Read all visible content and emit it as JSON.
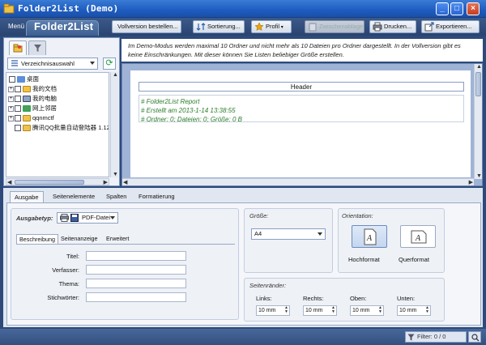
{
  "window": {
    "title": "Folder2List (Demo)"
  },
  "toolbar": {
    "menu": "Menü",
    "brand": "Folder2List",
    "buttons": {
      "buy": "Vollversion bestellen...",
      "sort": "Sortierung...",
      "profile": "Profil",
      "clipboard": "Zwischenablage",
      "print": "Drucken...",
      "export": "Exportieren..."
    }
  },
  "info_text": "Im Demo-Modus werden maximal 10 Ordner und nicht mehr als 10 Dateien pro Ordner dargestellt. In der Vollversion gibt es keine Einschränkungen. Mit dieser können Sie Listen beliebiger Größe erstellen.",
  "left": {
    "selector": "Verzeichnisauswahl",
    "tree": [
      {
        "label": "桌面",
        "level": 0
      },
      {
        "label": "我的文档",
        "level": 1
      },
      {
        "label": "我的电脑",
        "level": 1
      },
      {
        "label": "网上邻居",
        "level": 1
      },
      {
        "label": "qqnmctf",
        "level": 1
      },
      {
        "label": "腾讯QQ批量自动登陆器 1.12",
        "level": 1
      }
    ]
  },
  "preview": {
    "header": "Header",
    "lines": [
      "# Folder2List Report",
      "# Erstellt am 2013-1-14 13:38:55",
      "# Ordner: 0;  Dateien: 0;  Größe: 0 B"
    ]
  },
  "options": {
    "tabs": [
      "Ausgabe",
      "Seitenelemente",
      "Spalten",
      "Formatierung"
    ],
    "output_type_label": "Ausgabetyp:",
    "output_type": "PDF-Datei",
    "subtabs": [
      "Beschreibung",
      "Seitenanzeige",
      "Erweitert"
    ],
    "fields": [
      "Titel:",
      "Verfasser:",
      "Thema:",
      "Stichwörter:"
    ],
    "size_label": "Größe:",
    "size_value": "A4",
    "orientation_label": "Orientation:",
    "portrait": "Hochformat",
    "landscape": "Querformat",
    "margins_label": "Seitenränder:",
    "margins": [
      {
        "label": "Links:",
        "value": "10 mm"
      },
      {
        "label": "Rechts:",
        "value": "10 mm"
      },
      {
        "label": "Oben:",
        "value": "10 mm"
      },
      {
        "label": "Unten:",
        "value": "10 mm"
      }
    ]
  },
  "status": {
    "filter": "Filter: 0 / 0"
  },
  "colors": {
    "title_bar": "#1f5cc0",
    "toolbar": "#2a4470",
    "report_text": "#2c7d2c"
  }
}
